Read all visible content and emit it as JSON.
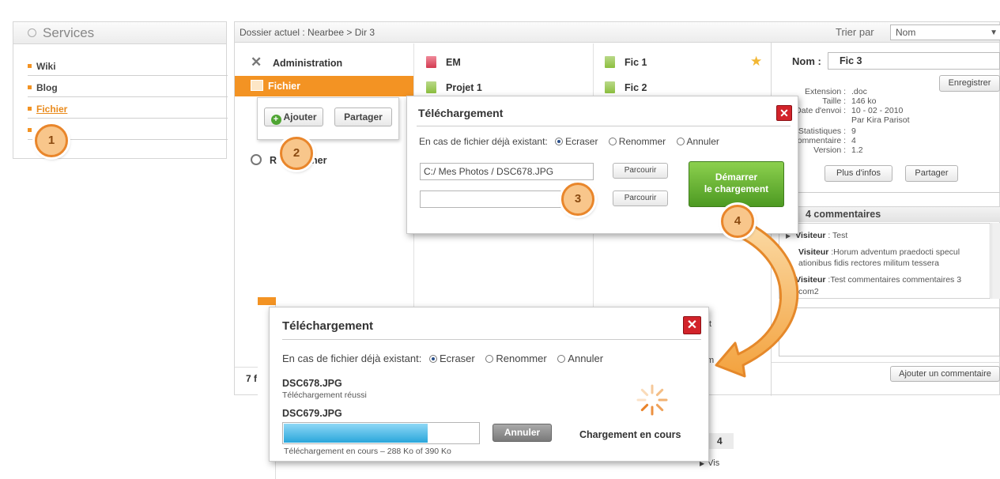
{
  "services": {
    "title": "Services",
    "items": [
      {
        "label": "Wiki",
        "active": false
      },
      {
        "label": "Blog",
        "active": false
      },
      {
        "label": "Fichier",
        "active": true
      },
      {
        "label": "",
        "active": false
      }
    ]
  },
  "header": {
    "breadcrumb": "Dossier actuel : Nearbee > Dir 3",
    "sort_label": "Trier par",
    "sort_value": "Nom"
  },
  "nav": {
    "items": [
      {
        "label": "Administration",
        "icon": "tools-icon"
      },
      {
        "label": "Fichier",
        "icon": "folder-icon",
        "active": true
      },
      {
        "label": "R",
        "icon": "search-icon"
      }
    ],
    "search_label_tail": "her",
    "popup_add": "Ajouter",
    "popup_share": "Partager",
    "footer_count": "7 f"
  },
  "files": {
    "col2": [
      {
        "label": "EM",
        "icon": "red-file-icon"
      },
      {
        "label": "Projet 1",
        "icon": "green-file-icon"
      }
    ],
    "col3": [
      {
        "label": "Fic 1",
        "icon": "green-file-icon",
        "starred": true
      },
      {
        "label": "Fic 2",
        "icon": "green-file-icon"
      }
    ]
  },
  "detail": {
    "name_label": "Nom :",
    "name_value": "Fic 3",
    "save": "Enregistrer",
    "meta": [
      {
        "k": "Extension :",
        "v": ".doc"
      },
      {
        "k": "Taille :",
        "v": "146 ko"
      },
      {
        "k": "Date d'envoi :",
        "v": "10 - 02 - 2010"
      },
      {
        "k": "",
        "v": "Par  Kira Parisot"
      },
      {
        "k": "Statistiques :",
        "v": "9"
      },
      {
        "k": "Commentaire :",
        "v": "4"
      },
      {
        "k": "Version :",
        "v": "1.2"
      }
    ],
    "more_info": "Plus d'infos",
    "share": "Partager",
    "comments_title": "4 commentaires",
    "comments": [
      {
        "author": "Visiteur",
        "text": " : Test"
      },
      {
        "author": "Visiteur",
        "text": " :Horum adventum praedocti specul",
        "text2": "ationibus fidis rectores militum tessera"
      },
      {
        "author": "Visiteur",
        "text": " :Test commentaires commentaires 3",
        "text2": "com2"
      }
    ],
    "add_comment": "Ajouter un commentaire"
  },
  "dialog1": {
    "title": "Téléchargement",
    "existing_label": "En cas de fichier déjà existant:",
    "options": [
      "Ecraser",
      "Renommer",
      "Annuler"
    ],
    "file1_value": "C:/ Mes Photos / DSC678.JPG",
    "file2_value": "",
    "browse": "Parcourir",
    "start_line1": "Démarrer",
    "start_line2": "le chargement"
  },
  "dialog2": {
    "title": "Téléchargement",
    "existing_label": "En cas de fichier déjà existant:",
    "options": [
      "Ecraser",
      "Renommer",
      "Annuler"
    ],
    "file1_name": "DSC678.JPG",
    "file1_status": "Téléchargement réussi",
    "file2_name": "DSC679.JPG",
    "cancel": "Annuler",
    "progress_text": "Téléchargement en cours – 288 Ko of 390 Ko",
    "progress_fraction": 0.74,
    "loading_label": "Chargement en cours"
  },
  "background_fragments": {
    "behind_dialog_a": "Projet 1",
    "behind_dialog_b": "Fic 3",
    "right_a": "Dat",
    "right_b": "St",
    "right_c": "Com",
    "right_d": "4",
    "right_e": "Vis"
  },
  "markers": [
    "1",
    "2",
    "3",
    "4"
  ],
  "colors": {
    "accent": "#f39323",
    "close": "#d2232a",
    "start_button": "#6bb33a",
    "progress": "#39b5e6"
  }
}
